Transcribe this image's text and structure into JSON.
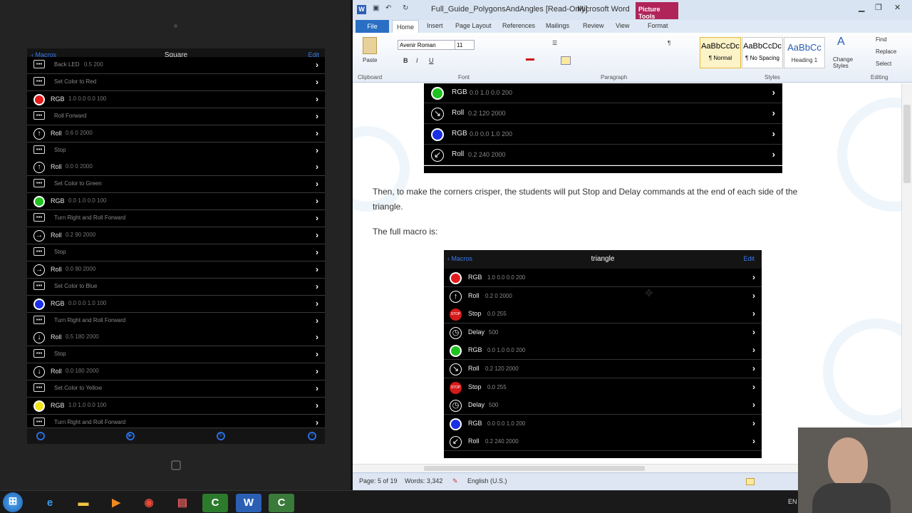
{
  "ipad": {
    "back_label": "Macros",
    "title": "Square",
    "edit_label": "Edit",
    "rows": [
      {
        "kind": "comment",
        "text": "Back LED",
        "args": "0.5 200"
      },
      {
        "kind": "comment",
        "text": "Set Color to Red"
      },
      {
        "kind": "rgb",
        "color": "#e41b1b",
        "cmd": "RGB",
        "args": "1.0 0.0 0.0 100"
      },
      {
        "kind": "comment",
        "text": "Roll Forward"
      },
      {
        "kind": "roll",
        "icon": "arrow-up-icon",
        "glyph": "↑",
        "cmd": "Roll",
        "args": "0.6 0 2000"
      },
      {
        "kind": "comment",
        "text": "Stop"
      },
      {
        "kind": "roll",
        "icon": "arrow-up-icon",
        "glyph": "↑",
        "cmd": "Roll",
        "args": "0.0 0 2000"
      },
      {
        "kind": "comment",
        "text": "Set Color to Green"
      },
      {
        "kind": "rgb",
        "color": "#1fc21f",
        "cmd": "RGB",
        "args": "0.0 1.0 0.0 100"
      },
      {
        "kind": "comment",
        "text": "Turn Right and Roll Forward"
      },
      {
        "kind": "roll",
        "icon": "arrow-right-icon",
        "glyph": "→",
        "cmd": "Roll",
        "args": "0.2 90 2000"
      },
      {
        "kind": "comment",
        "text": "Stop"
      },
      {
        "kind": "roll",
        "icon": "arrow-right-icon",
        "glyph": "→",
        "cmd": "Roll",
        "args": "0.0 90 2000"
      },
      {
        "kind": "comment",
        "text": "Set Color to Blue"
      },
      {
        "kind": "rgb",
        "color": "#1a2fe6",
        "cmd": "RGB",
        "args": "0.0 0.0 1.0 100"
      },
      {
        "kind": "comment",
        "text": "Turn Right and Roll Forward"
      },
      {
        "kind": "roll",
        "icon": "arrow-down-icon",
        "glyph": "↓",
        "cmd": "Roll",
        "args": "0.5 180 2000"
      },
      {
        "kind": "comment",
        "text": "Stop"
      },
      {
        "kind": "roll",
        "icon": "arrow-down-icon",
        "glyph": "↓",
        "cmd": "Roll",
        "args": "0.0 180 2000"
      },
      {
        "kind": "comment",
        "text": "Set Color to Yellow"
      },
      {
        "kind": "rgb",
        "color": "#f0e31a",
        "cmd": "RGB",
        "args": "1.0 1.0 0.0 100"
      },
      {
        "kind": "comment",
        "text": "Turn Right and Roll Forward"
      }
    ]
  },
  "word": {
    "filename": "Full_Guide_PolygonsAndAngles [Read-Only]",
    "app": "Microsoft Word",
    "picture_tools": "Picture Tools",
    "tabs": [
      "Home",
      "Insert",
      "Page Layout",
      "References",
      "Mailings",
      "Review",
      "View",
      "Format"
    ],
    "file_tab": "File",
    "font_name": "Avenir Roman",
    "font_size": "11",
    "paste_label": "Paste",
    "groups": {
      "clipboard": "Clipboard",
      "font": "Font",
      "paragraph": "Paragraph",
      "styles": "Styles",
      "editing": "Editing"
    },
    "styles": [
      {
        "sample": "AaBbCcDc",
        "name": "¶ Normal"
      },
      {
        "sample": "AaBbCcDc",
        "name": "¶ No Spacing"
      },
      {
        "sample": "AaBbCc",
        "name": "Heading 1"
      }
    ],
    "change_styles": "Change Styles",
    "editing_items": [
      "Find",
      "Replace",
      "Select"
    ],
    "top_rows": [
      {
        "kind": "rgb",
        "color": "#1fc21f",
        "cmd": "RGB",
        "args": "0.0 1.0 0.0 200"
      },
      {
        "kind": "roll",
        "icon": "arrow-down-right-icon",
        "glyph": "↘",
        "cmd": "Roll",
        "args": "0.2 120 2000"
      },
      {
        "kind": "rgb",
        "color": "#1a2fe6",
        "cmd": "RGB",
        "args": "0.0 0.0 1.0 200"
      },
      {
        "kind": "roll",
        "icon": "arrow-down-left-icon",
        "glyph": "↙",
        "cmd": "Roll",
        "args": "0.2 240 2000"
      }
    ],
    "para1": "Then, to make the corners crisper, the students will put Stop and Delay commands at the end of each side of the triangle.",
    "para2": "The full macro is:",
    "tri_back": "Macros",
    "tri_title": "triangle",
    "tri_edit": "Edit",
    "tri_rows": [
      {
        "kind": "rgb",
        "color": "#e41b1b",
        "cmd": "RGB",
        "args": "1.0 0.0 0.0 200"
      },
      {
        "kind": "roll",
        "icon": "arrow-up-icon",
        "glyph": "↑",
        "cmd": "Roll",
        "args": "0.2 0 2000"
      },
      {
        "kind": "stop",
        "color": "#d61a1a",
        "cmd": "Stop",
        "args": "0.0 255"
      },
      {
        "kind": "delay",
        "icon": "stopwatch-icon",
        "glyph": "◷",
        "cmd": "Delay",
        "args": "500"
      },
      {
        "kind": "rgb",
        "color": "#1fc21f",
        "cmd": "RGB",
        "args": "0.0 1.0 0.0 200"
      },
      {
        "kind": "roll",
        "icon": "arrow-down-right-icon",
        "glyph": "↘",
        "cmd": "Roll",
        "args": "0.2 120 2000"
      },
      {
        "kind": "stop",
        "color": "#d61a1a",
        "cmd": "Stop",
        "args": "0.0 255"
      },
      {
        "kind": "delay",
        "icon": "stopwatch-icon",
        "glyph": "◷",
        "cmd": "Delay",
        "args": "500"
      },
      {
        "kind": "rgb",
        "color": "#1a2fe6",
        "cmd": "RGB",
        "args": "0.0 0.0 1.0 200"
      },
      {
        "kind": "roll",
        "icon": "arrow-down-left-icon",
        "glyph": "↙",
        "cmd": "Roll",
        "args": "0.2 240 2000"
      }
    ],
    "status": {
      "page": "Page: 5 of 19",
      "words": "Words: 3,342",
      "lang": "English (U.S.)"
    }
  },
  "taskbar": {
    "lang": "EN"
  }
}
